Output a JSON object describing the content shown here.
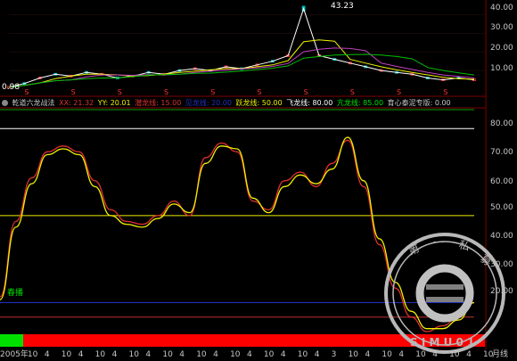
{
  "chart_data": [
    {
      "type": "line",
      "panel": "price",
      "x": [
        "2005",
        "2005-10",
        "2006-04",
        "2006-10",
        "2007-04",
        "2007-10",
        "2008-04",
        "2008-10",
        "2009-04",
        "2009-10",
        "2010-04",
        "2010-10",
        "2011-04",
        "2011-10",
        "2012-04",
        "2012-10",
        "2013-04",
        "2013-10",
        "2014-04",
        "2014-10",
        "2015-04",
        "2015-10",
        "2016-04",
        "2016-10",
        "2017-04",
        "2017-10",
        "2018-04",
        "2018-10",
        "2019-04",
        "2019-10",
        "2020-04"
      ],
      "series": [
        {
          "values": [
            1.0,
            3.0,
            6.0,
            8.0,
            7.0,
            9.0,
            8.0,
            6.0,
            7.0,
            9.0,
            8.0,
            10.0,
            11.0,
            10.0,
            12.0,
            11.0,
            13.0,
            15.0,
            18.0,
            43.23,
            18.0,
            16.0,
            14.0,
            12.0,
            10.0,
            9.0,
            8.0,
            6.0,
            5.0,
            6.0,
            5.0
          ]
        }
      ],
      "yticks": [
        10.0,
        20.0,
        30.0,
        40.0
      ],
      "ylim": [
        0,
        45
      ],
      "annotations": [
        "43.23",
        "0.98"
      ]
    },
    {
      "type": "line",
      "panel": "oscillator",
      "x": [
        "2005",
        "2005-10",
        "2006-04",
        "2006-10",
        "2007-04",
        "2007-10",
        "2008-04",
        "2008-10",
        "2009-04",
        "2009-10",
        "2010-04",
        "2010-10",
        "2011-04",
        "2011-10",
        "2012-04",
        "2012-10",
        "2013-04",
        "2013-10",
        "2014-04",
        "2014-10",
        "2015-04",
        "2015-10",
        "2016-04",
        "2016-10",
        "2017-04",
        "2017-10",
        "2018-04",
        "2018-10",
        "2019-04",
        "2019-10",
        "2020-04"
      ],
      "series": [
        {
          "name": "XX",
          "values": [
            22,
            48,
            63,
            72,
            74,
            72,
            62,
            52,
            48,
            47,
            50,
            55,
            50,
            70,
            75,
            72,
            55,
            52,
            62,
            65,
            60,
            68,
            76,
            60,
            40,
            25,
            15,
            10,
            12,
            15,
            20
          ]
        },
        {
          "name": "YY",
          "values": [
            21,
            46,
            61,
            71,
            73,
            71,
            60,
            50,
            47,
            46,
            49,
            54,
            51,
            68,
            74,
            73,
            56,
            51,
            60,
            64,
            61,
            66,
            77,
            62,
            42,
            27,
            17,
            11,
            11,
            14,
            20
          ]
        }
      ],
      "hlines": [
        80.0,
        50.0,
        20.0,
        15.0
      ],
      "yticks": [
        20.0,
        30.0,
        40.0,
        50.0,
        60.0,
        70.0,
        80.0
      ],
      "ylim": [
        10,
        85
      ]
    }
  ],
  "header": {
    "name": "乾道六龙战法",
    "xx": "XX: 21.32",
    "yy": "YY: 20.01",
    "qianlong": "潜龙线: 15.00",
    "hidden": "见龙线: 20.00",
    "yuelong": "跃龙线: 50.00",
    "feilong": "飞龙线: 80.00",
    "kanglong": "亢龙线: 85.00",
    "taini": "育心泰泥专版: 0.00"
  },
  "price_axis": [
    "40.00",
    "30.00",
    "20.00",
    "10.00"
  ],
  "osc_axis": [
    "80.00",
    "70.00",
    "60.00",
    "50.00",
    "40.00",
    "30.00",
    "20.00"
  ],
  "peak_label": "43.23",
  "low_label": "0.98",
  "sow_label": "春播",
  "x_labels": [
    "2005年",
    "10",
    "4",
    "10",
    "4",
    "10",
    "4",
    "10",
    "4",
    "10",
    "4",
    "10",
    "4",
    "10",
    "4",
    "10",
    "4",
    "10",
    "4",
    "3",
    "10",
    "4",
    "10",
    "4",
    "10",
    "4",
    "10",
    "4",
    "10"
  ],
  "period_label": "月线",
  "stamp": {
    "text": "第一私募",
    "sub": "SIMU01",
    "color": "#c0c0c0"
  },
  "colors": {
    "xx": "#e03030",
    "yy": "#f0f000",
    "red_band": "#ff0000",
    "green_band": "#00e000"
  }
}
